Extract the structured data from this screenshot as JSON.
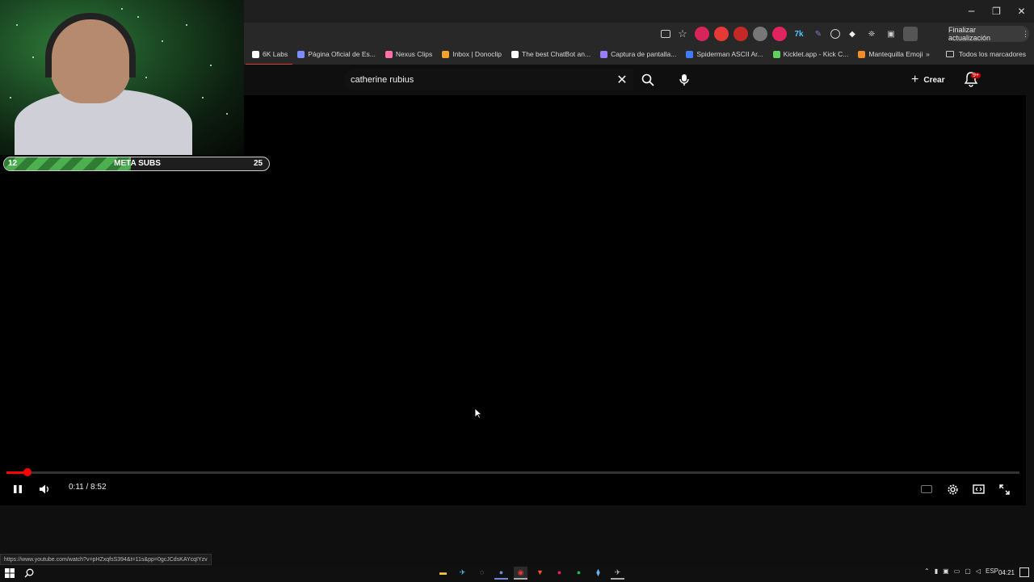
{
  "browser": {
    "update_label": "Finalizar actualización",
    "bookmarks": [
      {
        "label": "6K Labs",
        "color": "#ffffff"
      },
      {
        "label": "Página Oficial de Es...",
        "color": "#7f8cff"
      },
      {
        "label": "Nexus Clips",
        "color": "#ff6fa8"
      },
      {
        "label": "Inbox | Donoclip",
        "color": "#f2a32a"
      },
      {
        "label": "The best ChatBot an...",
        "color": "#ffffff"
      },
      {
        "label": "Captura de pantalla...",
        "color": "#9a7cff"
      },
      {
        "label": "Spiderman ASCII Ar...",
        "color": "#3f7dff"
      },
      {
        "label": "Kicklet.app - Kick C...",
        "color": "#5fd35f"
      },
      {
        "label": "Mantequilla Emoji",
        "color": "#f28b2a"
      }
    ],
    "all_bookmarks_label": "Todos los marcadores",
    "more_bookmarks_label": "»"
  },
  "youtube": {
    "search_value": "catherine rubius",
    "create_label": "Crear",
    "notification_count": "9+"
  },
  "goal": {
    "current": "12",
    "label": "META SUBS",
    "target": "25",
    "fill_fraction": 0.48
  },
  "player": {
    "time_display": "0:11 / 8:52",
    "progress_fraction": 0.0207
  },
  "status_url": "https://www.youtube.com/watch?v=pHZxqfsS394&t=11s&pp=0gcJCdsKAYcqIYzv",
  "taskbar": {
    "language": "ESP",
    "time": "04:21"
  }
}
